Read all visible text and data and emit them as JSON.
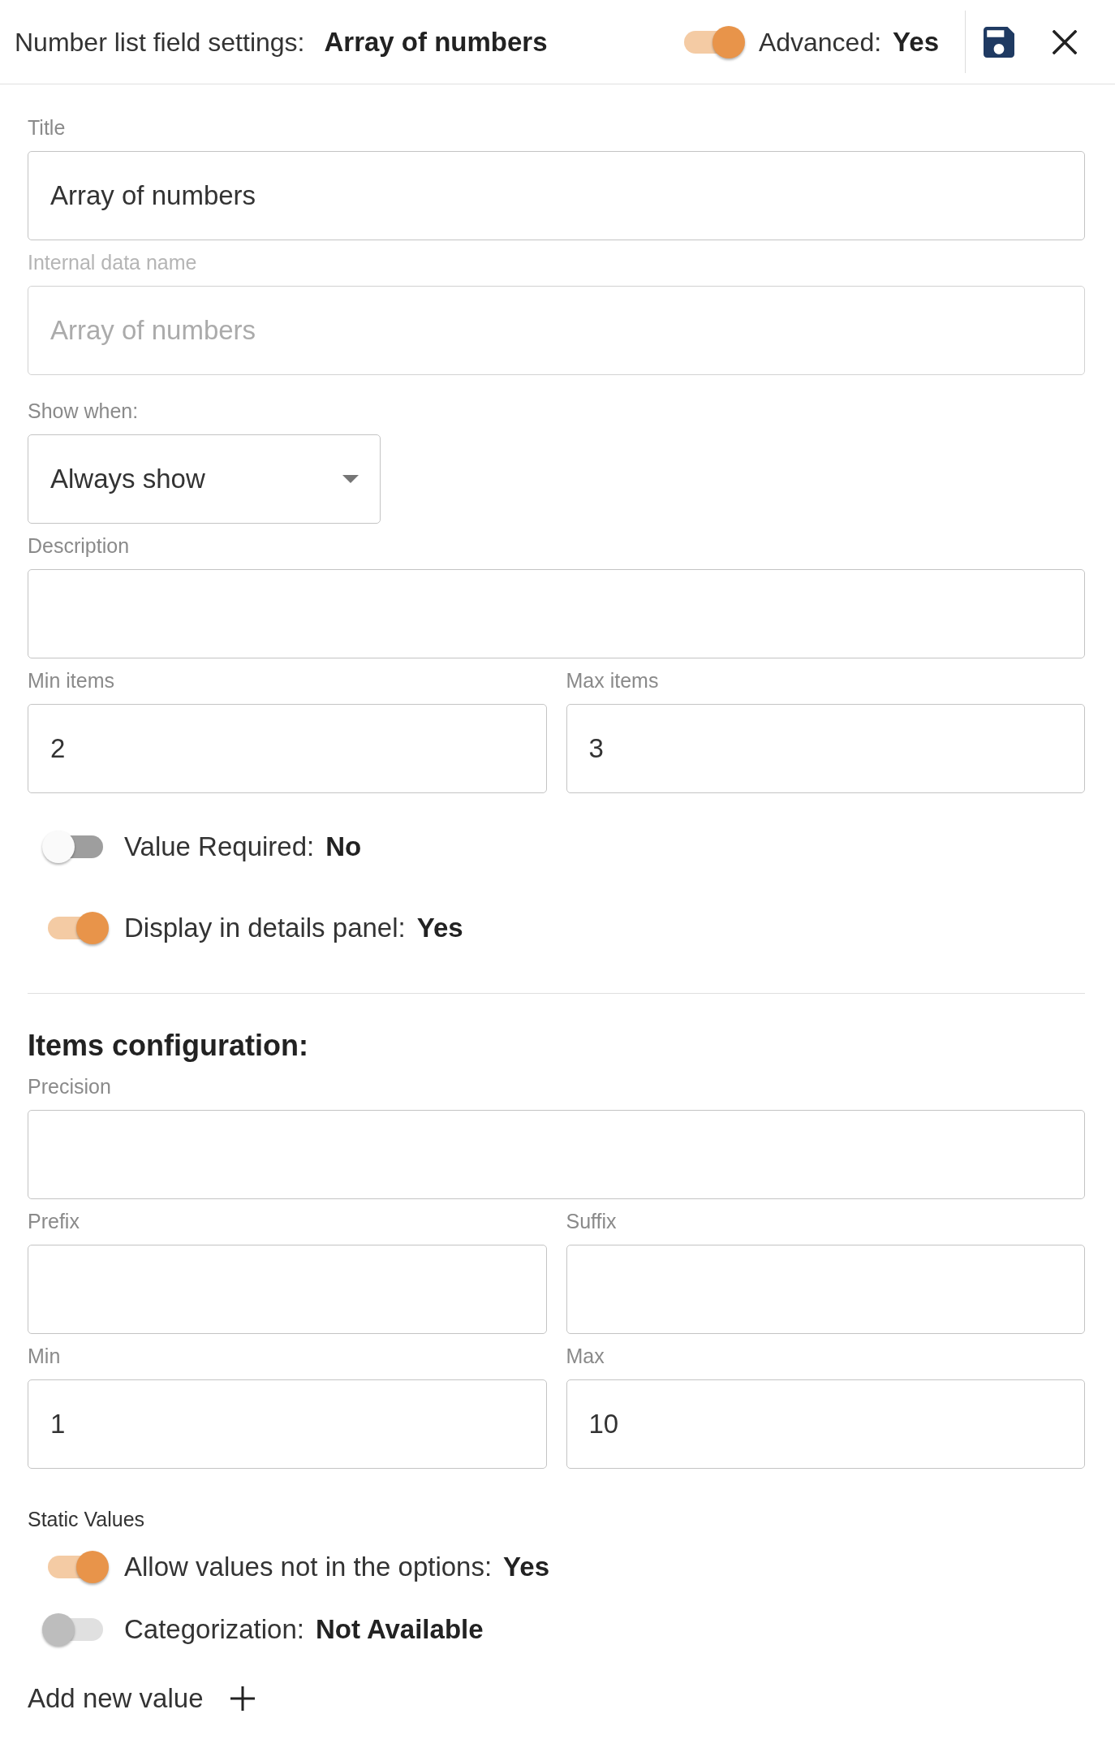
{
  "header": {
    "title": "Number list field settings:",
    "field_name": "Array of numbers",
    "advanced": {
      "label": "Advanced:",
      "value": "Yes",
      "on": true
    }
  },
  "general": {
    "rows": [
      [
        {
          "kind": "text",
          "label": "Title",
          "value": "Array of numbers",
          "disabled": false
        }
      ],
      [
        {
          "kind": "text",
          "label": "Internal data name",
          "placeholder": "Array of numbers",
          "disabled": true
        }
      ],
      [
        {
          "kind": "select",
          "label": "Show when:",
          "value": "Always show",
          "disabled": false
        }
      ],
      [
        {
          "kind": "text",
          "label": "Description",
          "disabled": false
        }
      ],
      [
        {
          "kind": "text",
          "label": "Min items",
          "value": "2",
          "disabled": false
        },
        {
          "kind": "text",
          "label": "Max items",
          "value": "3",
          "disabled": false
        }
      ]
    ],
    "toggles": [
      {
        "label": "Value Required:",
        "value": "No",
        "on": false,
        "disabled": false
      },
      {
        "label": "Display in details panel:",
        "value": "Yes",
        "on": true,
        "disabled": false
      }
    ]
  },
  "items_configuration": {
    "heading": "Items configuration:",
    "rows": [
      [
        {
          "kind": "text",
          "label": "Precision",
          "disabled": false
        }
      ],
      [
        {
          "kind": "text",
          "label": "Prefix",
          "disabled": false
        },
        {
          "kind": "text",
          "label": "Suffix",
          "disabled": false
        }
      ],
      [
        {
          "kind": "text",
          "label": "Min",
          "value": "1",
          "disabled": false
        },
        {
          "kind": "text",
          "label": "Max",
          "value": "10",
          "disabled": false
        }
      ]
    ]
  },
  "static_values": {
    "heading": "Static Values",
    "toggles": [
      {
        "label": "Allow values not in the options:",
        "value": "Yes",
        "on": true,
        "disabled": false
      },
      {
        "label": "Categorization:",
        "value": "Not Available",
        "on": false,
        "disabled": true
      }
    ],
    "add_button": "Add new value"
  }
}
